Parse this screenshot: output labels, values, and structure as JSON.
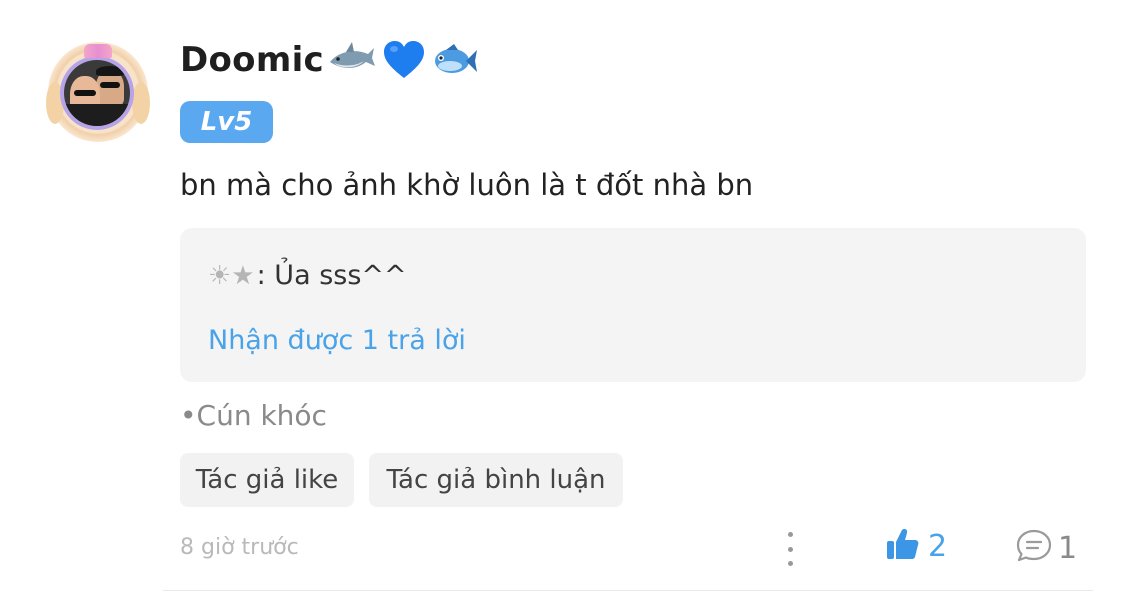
{
  "comment": {
    "username": "Doomic",
    "username_emojis": [
      "shark-emoji",
      "blue-heart-emoji",
      "fish-emoji"
    ],
    "level": "Lv5",
    "text": "bn mà cho ảnh khờ luôn là t đốt nhà bn",
    "reply_preview": {
      "symbols": "☀★",
      "text": ": Ủa sss^^",
      "replies_link": "Nhận được 1 trả lời"
    },
    "tag": "•Cún khóc",
    "author_chips": [
      "Tác giả like",
      "Tác giả bình luận"
    ],
    "timestamp": "8 giờ trước",
    "likes": "2",
    "replies": "1"
  },
  "colors": {
    "accent_blue": "#4aa3e8",
    "badge_blue": "#5aa8ef",
    "reply_bg": "#f4f4f5",
    "chip_bg": "#f2f2f2"
  },
  "icons": [
    "more-vertical-icon",
    "thumbs-up-icon",
    "comment-bubble-icon"
  ]
}
